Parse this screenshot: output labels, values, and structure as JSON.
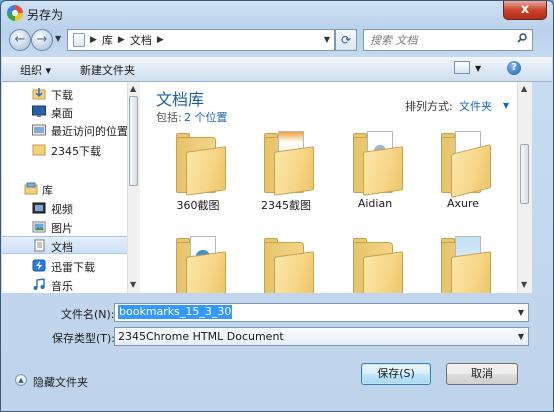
{
  "window": {
    "title": "另存为",
    "close_glyph": "x"
  },
  "nav": {
    "breadcrumb": [
      "库",
      "文档"
    ],
    "search_placeholder": "搜索 文档"
  },
  "toolbar": {
    "organize": "组织 ▾",
    "new_folder": "新建文件夹",
    "help": "?"
  },
  "sidebar": {
    "items": [
      {
        "label": "下载",
        "icon": "download-folder-icon"
      },
      {
        "label": "桌面",
        "icon": "desktop-icon"
      },
      {
        "label": "最近访问的位置",
        "icon": "recent-places-icon"
      },
      {
        "label": "2345下载",
        "icon": "folder-icon"
      },
      {
        "label": "库",
        "icon": "library-icon"
      },
      {
        "label": "视频",
        "icon": "video-library-icon"
      },
      {
        "label": "图片",
        "icon": "pictures-library-icon"
      },
      {
        "label": "文档",
        "icon": "documents-library-icon",
        "selected": true
      },
      {
        "label": "迅雷下载",
        "icon": "thunder-download-icon"
      },
      {
        "label": "音乐",
        "icon": "music-library-icon"
      }
    ]
  },
  "library": {
    "title": "文档库",
    "includes_prefix": "包括:",
    "includes_link": "2 个位置",
    "arrange_label": "排列方式:",
    "arrange_value": "文件夹"
  },
  "folders": [
    {
      "name": "360截图",
      "icon": "folder-icon"
    },
    {
      "name": "2345截图",
      "icon": "folder-with-screenshots-icon"
    },
    {
      "name": "Aidian",
      "icon": "folder-with-settings-icon"
    },
    {
      "name": "Axure",
      "icon": "folder-with-documents-icon"
    },
    {
      "name": "",
      "icon": "folder-with-globe-document-icon"
    },
    {
      "name": "",
      "icon": "folder-icon"
    },
    {
      "name": "",
      "icon": "folder-with-music-icon"
    },
    {
      "name": "",
      "icon": "folder-with-picture-icon"
    }
  ],
  "form": {
    "filename_label": "文件名(N):",
    "filename_value": "bookmarks_15_3_30",
    "filetype_label": "保存类型(T):",
    "filetype_value": "2345Chrome HTML Document"
  },
  "footer": {
    "hide_folders": "隐藏文件夹",
    "save": "保存(S)",
    "cancel": "取消"
  }
}
